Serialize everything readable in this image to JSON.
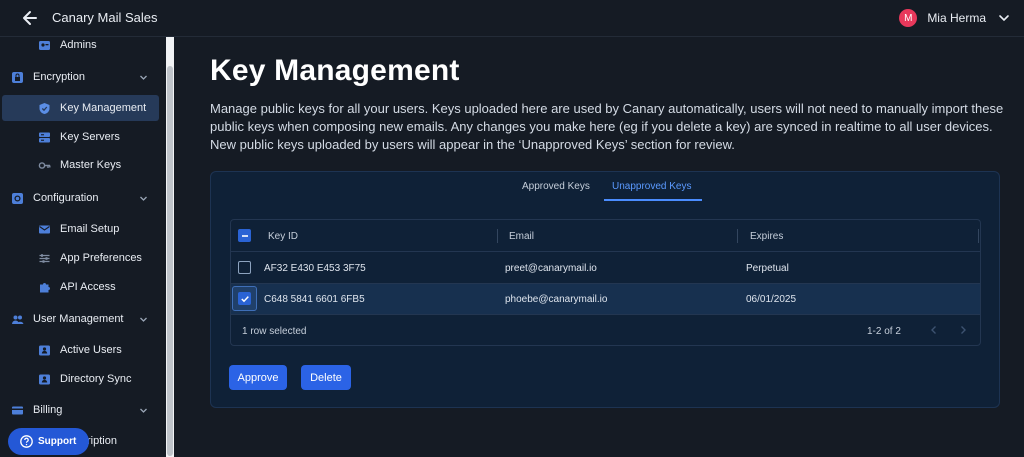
{
  "header": {
    "title": "Canary Mail Sales",
    "user_name": "Mia Herma",
    "avatar_initial": "M"
  },
  "sidebar": {
    "items": [
      {
        "label": "Admins",
        "icon": "admins-icon"
      },
      {
        "label": "Encryption",
        "icon": "lock-icon"
      },
      {
        "label": "Key Management",
        "icon": "shield-icon"
      },
      {
        "label": "Key Servers",
        "icon": "server-icon"
      },
      {
        "label": "Master Keys",
        "icon": "key-icon"
      },
      {
        "label": "Configuration",
        "icon": "gear-icon"
      },
      {
        "label": "Email Setup",
        "icon": "mail-icon"
      },
      {
        "label": "App Preferences",
        "icon": "sliders-icon"
      },
      {
        "label": "API Access",
        "icon": "puzzle-icon"
      },
      {
        "label": "User Management",
        "icon": "users-icon"
      },
      {
        "label": "Active Users",
        "icon": "active-user-icon"
      },
      {
        "label": "Directory Sync",
        "icon": "sync-icon"
      },
      {
        "label": "Billing",
        "icon": "card-icon"
      }
    ],
    "support_label": "Support",
    "support_tail": "ription"
  },
  "main": {
    "title": "Key Management",
    "description": "Manage public keys for all your users. Keys uploaded here are used by Canary automatically, users will not need to manually import these public keys when composing new emails. Any changes you make here (eg if you delete a key) are synced in realtime to all user devices. New public keys uploaded by users will appear in the ‘Unapproved Keys’ section for review.",
    "tabs": [
      {
        "label": "Approved Keys",
        "active": false
      },
      {
        "label": "Unapproved Keys",
        "active": true
      }
    ],
    "table": {
      "columns": [
        "Key ID",
        "Email",
        "Expires"
      ],
      "rows": [
        {
          "key_id": "AF32 E430 E453 3F75",
          "email": "preet@canarymail.io",
          "expires": "Perpetual",
          "selected": false
        },
        {
          "key_id": "C648 5841 6601 6FB5",
          "email": "phoebe@canarymail.io",
          "expires": "06/01/2025",
          "selected": true
        }
      ],
      "footer_selected": "1 row selected",
      "footer_pages": "1-2 of 2"
    },
    "actions": {
      "approve_label": "Approve",
      "delete_label": "Delete"
    }
  },
  "colors": {
    "accent": "#2b63e6",
    "background": "#151b24",
    "panel": "#0f2137",
    "active_tab": "#5b9aff",
    "avatar": "#e8385b"
  }
}
